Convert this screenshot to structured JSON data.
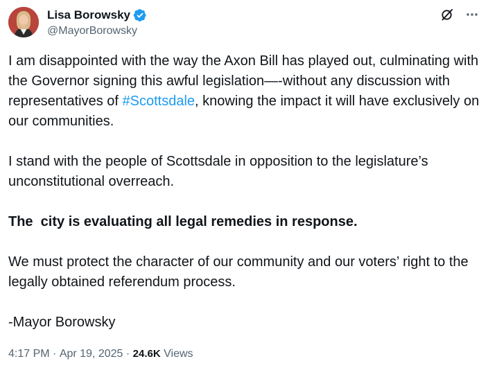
{
  "author": {
    "display_name": "Lisa Borowsky",
    "handle": "@MayorBorowsky",
    "verified_color": "#1d9bf0"
  },
  "icons": {
    "grok": "grok-icon",
    "more": "more-icon"
  },
  "tweet": {
    "p1_before": "I am disappointed with the way the Axon Bill has played out, culminating with the Governor signing this awful legislation—-without any discussion with representatives of ",
    "p1_hashtag": "#Scottsdale",
    "p1_after": ", knowing the impact it will have exclusively on our communities.",
    "p2": "I stand with the people of Scottsdale in opposition to the legislature’s unconstitutional overreach.",
    "p3": "The  city is evaluating all legal remedies in response.",
    "p4": "We must protect the character of our community and our voters’ right to the legally obtained referendum process.",
    "p5": "-Mayor Borowsky"
  },
  "meta": {
    "time": "4:17 PM",
    "separator": " · ",
    "date": "Apr 19, 2025",
    "views_count": "24.6K",
    "views_label": " Views"
  },
  "colors": {
    "text": "#0f1419",
    "secondary": "#536471",
    "link": "#1d9bf0"
  }
}
